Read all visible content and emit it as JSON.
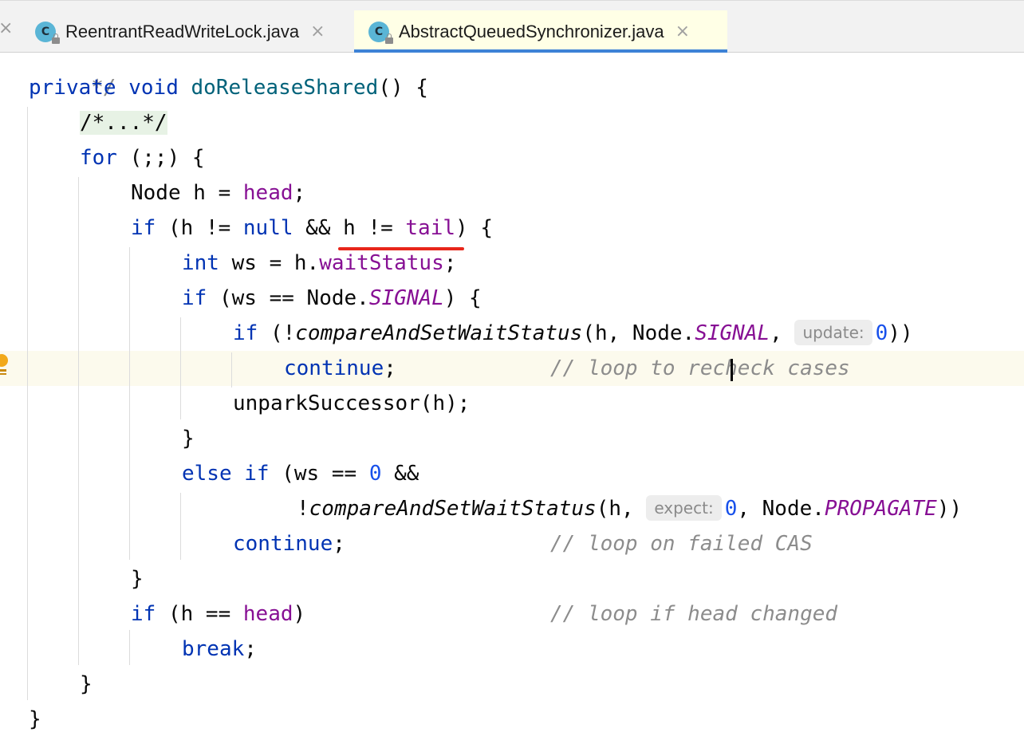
{
  "tabs": [
    {
      "label": "ReentrantReadWriteLock.java",
      "icon": "class-icon",
      "active": false
    },
    {
      "label": "AbstractQueuedSynchronizer.java",
      "icon": "class-icon",
      "active": true
    }
  ],
  "tab_icon_letter": "C",
  "tab_close_glyph": "×",
  "colors": {
    "keyword": "#0033b3",
    "method_decl": "#00627a",
    "field": "#871094",
    "number": "#1750eb",
    "comment": "#8c8c8c",
    "active_tab_underline": "#3d82d6",
    "annotation_underline": "#e8261b",
    "caret_line": "#fcfaed"
  },
  "code": {
    "partial_comment": " */",
    "l1": {
      "kw1": "private",
      "kw2": "void",
      "name": "doReleaseShared",
      "rest": "() {"
    },
    "l2": {
      "fold": "/*...*/"
    },
    "l3": {
      "kw": "for",
      "rest": " (;;) {"
    },
    "l4": {
      "a": "Node h = ",
      "field": "head",
      "b": ";"
    },
    "l5": {
      "kw": "if",
      "a": " (h != ",
      "kw_null": "null",
      "b": " && h != ",
      "field": "tail",
      "c": ") {"
    },
    "l6": {
      "kw": "int",
      "a": " ws = h.",
      "field": "waitStatus",
      "b": ";"
    },
    "l7": {
      "kw": "if",
      "a": " (ws == Node.",
      "static": "SIGNAL",
      "b": ") {"
    },
    "l8": {
      "kw": "if",
      "a": " (!",
      "method": "compareAndSetWaitStatus",
      "b": "(h, Node.",
      "static": "SIGNAL",
      "c": ", ",
      "hint": "update:",
      "num": "0",
      "d": "))"
    },
    "l9": {
      "kw": "continue",
      "a": ";",
      "comment": "// loop to recheck cases"
    },
    "l10": {
      "a": "unparkSuccessor(h);"
    },
    "l11": {
      "a": "}"
    },
    "l12": {
      "kw1": "else",
      "kw2": "if",
      "a": " (ws == ",
      "num": "0",
      "b": " &&"
    },
    "l13": {
      "a": "!",
      "method": "compareAndSetWaitStatus",
      "b": "(h, ",
      "hint": "expect:",
      "num": "0",
      "c": ", Node.",
      "static": "PROPAGATE",
      "d": "))"
    },
    "l14": {
      "kw": "continue",
      "a": ";",
      "comment": "// loop on failed CAS"
    },
    "l15": {
      "a": "}"
    },
    "l16": {
      "kw": "if",
      "a": " (h == ",
      "field": "head",
      "b": ")",
      "comment": "// loop if head changed"
    },
    "l17": {
      "kw": "break",
      "a": ";"
    },
    "l18": {
      "a": "}"
    },
    "l19": {
      "a": "}"
    }
  }
}
